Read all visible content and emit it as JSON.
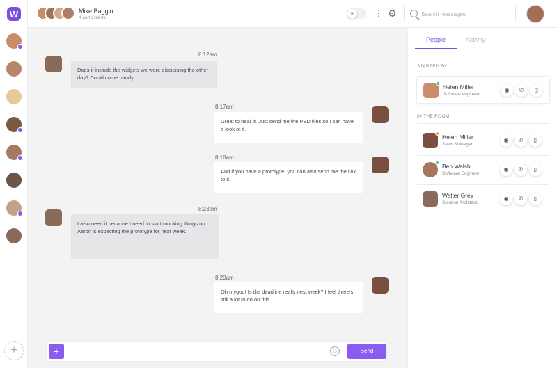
{
  "app": {
    "logo": "W",
    "accent": "#8a5cf0"
  },
  "header": {
    "conversation_name": "Mike Baggio",
    "participants": "4 participants",
    "search_placeholder": "Search messages"
  },
  "rail": {
    "avatars": [
      {
        "color": "#c98d6a",
        "badge": true
      },
      {
        "color": "#b8866a",
        "badge": false
      },
      {
        "color": "#e8c79a",
        "badge": false
      },
      {
        "color": "#7a5a45",
        "badge": true
      },
      {
        "color": "#a27a66",
        "badge": true
      },
      {
        "color": "#6a5548",
        "badge": false
      },
      {
        "color": "#c7a088",
        "badge": true
      },
      {
        "color": "#8a6a58",
        "badge": false
      }
    ],
    "add_label": "+"
  },
  "messages": [
    {
      "time": "8:12am",
      "text": "Does it include the widgets we were discussing the other day? Could come handy",
      "direction": "in"
    },
    {
      "time": "8:17am",
      "text": "Great to hear it. Just send me the PSD files so I can have a look at it.",
      "direction": "out"
    },
    {
      "time": "8:18am",
      "text": "And if you have a prototype, you can also send me the link to it.",
      "direction": "out"
    },
    {
      "time": "8:23am",
      "text": "I also need it because I need to start mocking things up. Aaron is expecting the prototype for next week.",
      "direction": "in"
    },
    {
      "time": "8:29am",
      "text": "Oh mygod! Is the deadline really nest week? I feel there's still a lot to do on this.",
      "direction": "out"
    }
  ],
  "composer": {
    "add": "+",
    "send_label": "Send",
    "value": ""
  },
  "panel": {
    "tabs": [
      "People",
      "Activity"
    ],
    "started_by_label": "STARTED BY",
    "in_room_label": "IN THE ROOM",
    "started_by": {
      "name": "Helen Miller",
      "role": "Software engineer",
      "status": "#2ecc71"
    },
    "room": [
      {
        "name": "Helen Miller",
        "role": "Sales Manager",
        "status": "#f0a030"
      },
      {
        "name": "Ben Walsh",
        "role": "Software Engineer",
        "status": "#2ecc71"
      },
      {
        "name": "Walter Grey",
        "role": "Solution Architect",
        "status": ""
      }
    ]
  }
}
